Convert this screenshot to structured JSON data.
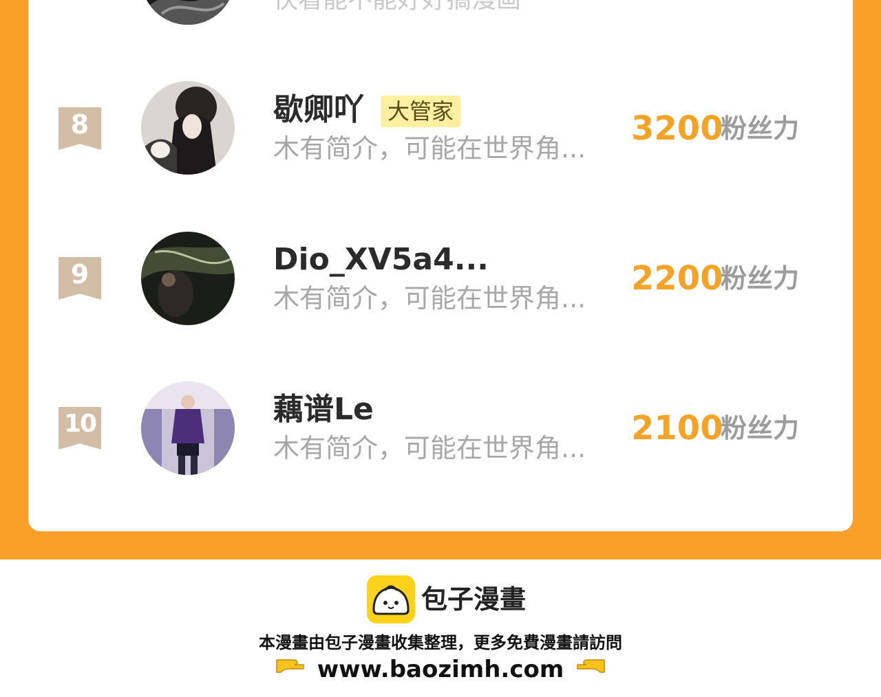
{
  "previous_row": {
    "desc": "快看能不能好好搞漫画"
  },
  "rows": [
    {
      "rank": "8",
      "name": "歇卿吖",
      "badge": "大管家",
      "desc": "木有简介，可能在世界角...",
      "score": "3200",
      "unit": "粉丝力"
    },
    {
      "rank": "9",
      "name": "Dio_XV5a4...",
      "badge": "",
      "desc": "木有简介，可能在世界角...",
      "score": "2200",
      "unit": "粉丝力"
    },
    {
      "rank": "10",
      "name": "藕谱Le",
      "badge": "",
      "desc": "木有简介，可能在世界角...",
      "score": "2100",
      "unit": "粉丝力"
    }
  ],
  "footer": {
    "brand": "包子漫畫",
    "note": "本漫畫由包子漫畫收集整理，更多免費漫畫請訪問",
    "url": "www.baozimh.com",
    "icons": [
      "bun-logo-icon",
      "pointing-right-hand-icon",
      "pointing-left-hand-icon"
    ]
  },
  "colors": {
    "frame": "#fb9f2b",
    "score": "#f2a428",
    "rank_ribbon": "#d2bda6",
    "badge_bg": "#fdf0a0",
    "logo": "#fcd21c"
  }
}
